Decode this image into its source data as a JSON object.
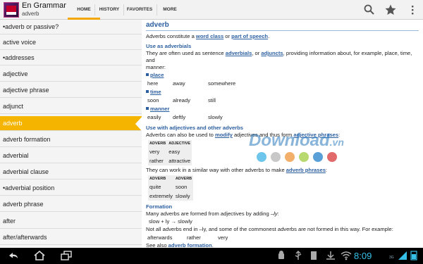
{
  "app": {
    "title": "En Grammar",
    "subtitle": "adverb"
  },
  "tabs": [
    {
      "label": "HOME",
      "active": true
    },
    {
      "label": "HISTORY"
    },
    {
      "label": "FAVORITES"
    },
    {
      "label": "MORE"
    }
  ],
  "actions": [
    "search-icon",
    "star-icon",
    "overflow-menu-icon"
  ],
  "list": {
    "items": [
      "•adverb or passive?",
      "active voice",
      "•addresses",
      "adjective",
      "adjective phrase",
      "adjunct",
      "adverb",
      "adverb formation",
      "adverbial",
      "adverbial clause",
      "•adverbial position",
      "adverb phrase",
      "after",
      "after/afterwards"
    ],
    "selected_index": 6
  },
  "entry": {
    "title": "adverb",
    "intro": {
      "t1": "Adverbs constitute a ",
      "l1": "word class",
      "t2": " or ",
      "l2": "part of speech",
      "t3": "."
    },
    "use_as_adverbials": {
      "heading": "Use as adverbials",
      "line1_t1": "They are often used as sentence ",
      "line1_l1": "adverbials",
      "line1_t2": ", or ",
      "line1_l2": "adjuncts",
      "line1_t3": ", providing information about, for example, place, time, and",
      "line2": "manner:",
      "place": {
        "label": "place",
        "words": [
          "here",
          "away",
          "somewhere"
        ]
      },
      "time": {
        "label": "time",
        "words": [
          "soon",
          "already",
          "still"
        ]
      },
      "manner": {
        "label": "manner",
        "words": [
          "easily",
          "deftly",
          "slowly"
        ]
      }
    },
    "use_with_adjectives": {
      "heading": "Use with adjectives and other adverbs",
      "line_t1": "Adverbs can also be used to ",
      "line_l1": "modify",
      "line_t2": " adjectives and thus form ",
      "line_l2": "adjective phrases",
      "line_t3": ":",
      "table1": {
        "headers": [
          "ADVERB",
          "ADJECTIVE"
        ],
        "rows": [
          [
            "very",
            "easy"
          ],
          [
            "rather",
            "attractive"
          ]
        ]
      },
      "line2_t1": "They can work in a similar way with other adverbs to make ",
      "line2_l1": "adverb phrases",
      "line2_t2": ":",
      "table2": {
        "headers": [
          "ADVERB",
          "ADVERB"
        ],
        "rows": [
          [
            "quite",
            "soon"
          ],
          [
            "extremely",
            "slowly"
          ]
        ]
      }
    },
    "formation": {
      "heading": "Formation",
      "line1_t1": "Many adverbs are formed from adjectives by adding ",
      "line1_i": "–ly",
      "line1_t2": ":",
      "example": "slow + ly → slowly",
      "line2": "Not all adverbs end in –ly, and some of the commonest adverbs are not formed in this way. For example:",
      "words": [
        "afterwards",
        "rather",
        "very"
      ],
      "see_t1": "See also ",
      "see_l1": "adverb formation",
      "see_t2": "."
    }
  },
  "watermark": {
    "text": "Download",
    "suffix": ".vn",
    "dot_colors": [
      "#6fc6ec",
      "#c8c8c8",
      "#f2b06a",
      "#b8d870",
      "#5aa0d8",
      "#e36a6a"
    ]
  },
  "system": {
    "time": "8:09",
    "network": "3G"
  },
  "colors": {
    "accent": "#f5b400",
    "link": "#2c5fa0",
    "clock": "#35c0e8"
  }
}
